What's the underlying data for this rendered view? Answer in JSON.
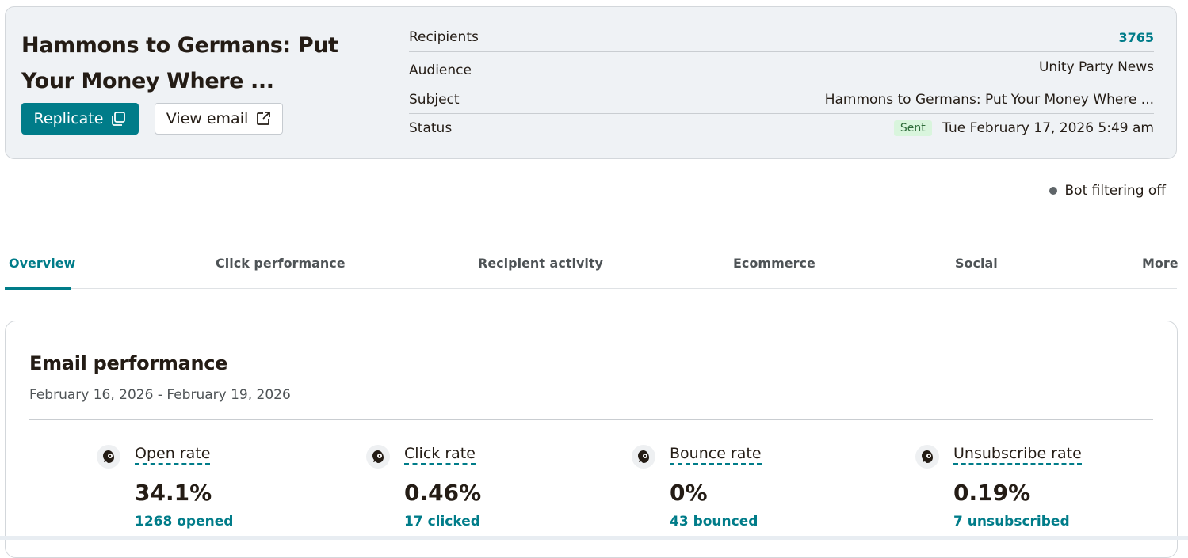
{
  "campaign": {
    "title": "Hammons to Germans: Put Your Money Where ...",
    "replicate_label": "Replicate",
    "view_email_label": "View email"
  },
  "details": {
    "recipients_label": "Recipients",
    "recipients_value": "3765",
    "audience_label": "Audience",
    "audience_value": "Unity Party News",
    "subject_label": "Subject",
    "subject_value": "Hammons to Germans: Put Your Money Where ...",
    "status_label": "Status",
    "status_badge": "Sent",
    "status_value": "Tue February 17, 2026 5:49 am"
  },
  "bot_filter": "Bot filtering off",
  "tabs": {
    "overview": "Overview",
    "click_performance": "Click performance",
    "recipient_activity": "Recipient activity",
    "ecommerce": "Ecommerce",
    "social": "Social",
    "more": "More"
  },
  "performance": {
    "title": "Email performance",
    "date_range": "February 16, 2026 - February 19, 2026",
    "stats": [
      {
        "label": "Open rate",
        "value": "34.1%",
        "sub": "1268 opened",
        "icon": "mailchimp-freddie-icon"
      },
      {
        "label": "Click rate",
        "value": "0.46%",
        "sub": "17 clicked",
        "icon": "mailchimp-freddie-icon"
      },
      {
        "label": "Bounce rate",
        "value": "0%",
        "sub": "43 bounced",
        "icon": "mailchimp-freddie-icon"
      },
      {
        "label": "Unsubscribe rate",
        "value": "0.19%",
        "sub": "7 unsubscribed",
        "icon": "mailchimp-freddie-icon"
      }
    ]
  },
  "colors": {
    "accent": "#007c89",
    "summary_bg": "#eff2f5",
    "text": "#241c15",
    "badge_bg": "#d9f5dd"
  }
}
